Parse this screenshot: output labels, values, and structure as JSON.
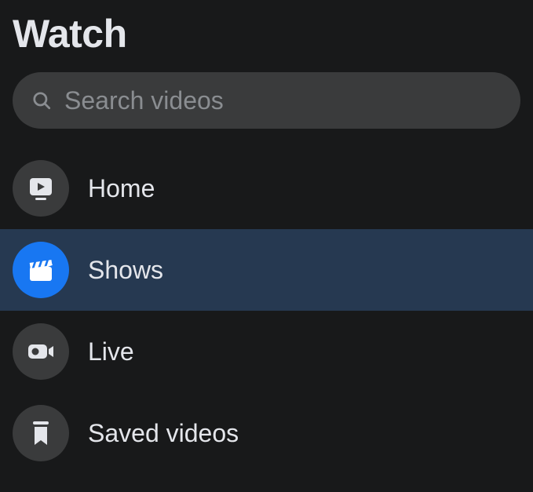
{
  "page": {
    "title": "Watch"
  },
  "search": {
    "placeholder": "Search videos"
  },
  "nav": {
    "items": [
      {
        "label": "Home",
        "icon": "home",
        "active": false
      },
      {
        "label": "Shows",
        "icon": "shows",
        "active": true
      },
      {
        "label": "Live",
        "icon": "live",
        "active": false
      },
      {
        "label": "Saved videos",
        "icon": "saved",
        "active": false
      }
    ]
  }
}
